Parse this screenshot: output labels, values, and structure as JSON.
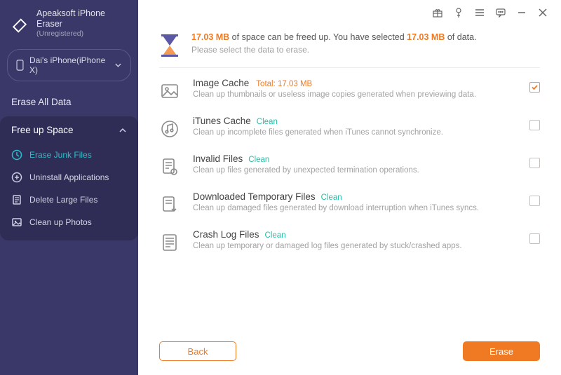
{
  "brand": {
    "name": "Apeaksoft iPhone Eraser",
    "status": "(Unregistered)"
  },
  "device": {
    "label": "Dai's iPhone(iPhone X)"
  },
  "nav": {
    "erase_all": "Erase All Data",
    "free_up": "Free up Space",
    "items": [
      {
        "label": "Erase Junk Files"
      },
      {
        "label": "Uninstall Applications"
      },
      {
        "label": "Delete Large Files"
      },
      {
        "label": "Clean up Photos"
      }
    ]
  },
  "banner": {
    "l1_pre": "",
    "size1": "17.03 MB",
    "l1_mid": " of space can be freed up. You have selected ",
    "size2": "17.03 MB",
    "l1_post": " of data.",
    "l2": "Please select the data to erase."
  },
  "rows": [
    {
      "title": "Image Cache",
      "status_kind": "total",
      "status": "Total: 17.03 MB",
      "sub": "Clean up thumbnails or useless image copies generated when previewing data.",
      "checked": true
    },
    {
      "title": "iTunes Cache",
      "status_kind": "clean",
      "status": "Clean",
      "sub": "Clean up incomplete files generated when iTunes cannot synchronize.",
      "checked": false
    },
    {
      "title": "Invalid Files",
      "status_kind": "clean",
      "status": "Clean",
      "sub": "Clean up files generated by unexpected termination operations.",
      "checked": false
    },
    {
      "title": "Downloaded Temporary Files",
      "status_kind": "clean",
      "status": "Clean",
      "sub": "Clean up damaged files generated by download interruption when iTunes syncs.",
      "checked": false
    },
    {
      "title": "Crash Log Files",
      "status_kind": "clean",
      "status": "Clean",
      "sub": "Clean up temporary or damaged log files generated by stuck/crashed apps.",
      "checked": false
    }
  ],
  "buttons": {
    "back": "Back",
    "erase": "Erase"
  }
}
